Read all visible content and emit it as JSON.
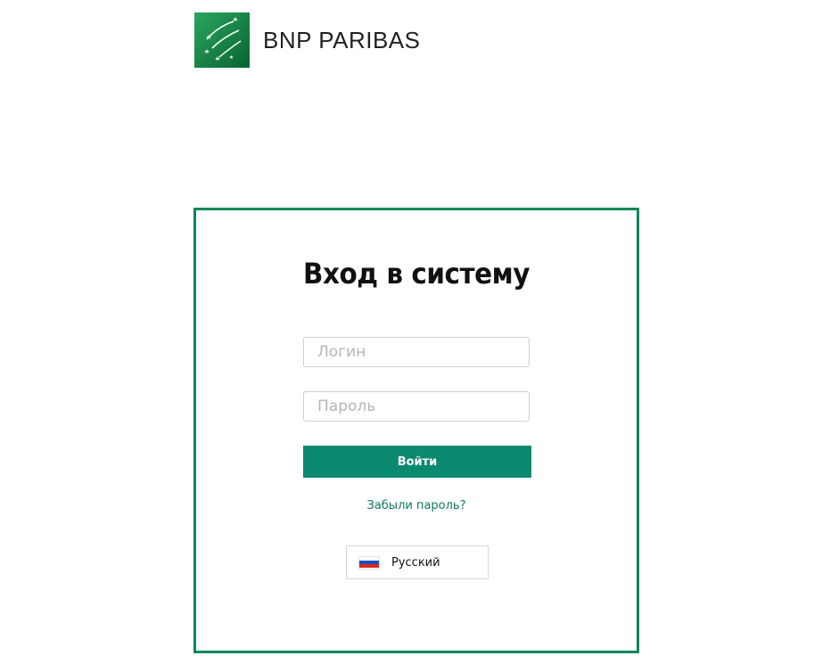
{
  "brand": {
    "name": "BNP PARIBAS",
    "logo_icon": "bnp-stars-logo",
    "logo_color": "#0b7a3c"
  },
  "login": {
    "title": "Вход в систему",
    "login_placeholder": "Логин",
    "password_placeholder": "Пароль",
    "submit_label": "Войти",
    "forgot_label": "Забыли пароль?",
    "border_color": "#00875a",
    "button_color": "#0c8a6f"
  },
  "language": {
    "selected": "Русский",
    "flag_icon": "russia-flag-icon"
  }
}
